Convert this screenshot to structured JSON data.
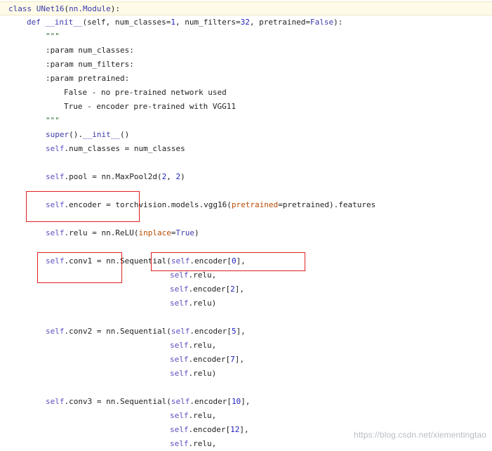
{
  "code_lines": [
    {
      "indent": 0,
      "highlight": true,
      "tokens": [
        {
          "t": "keyword",
          "v": "class "
        },
        {
          "t": "builtin",
          "v": "UNet16"
        },
        {
          "t": "text",
          "v": "("
        },
        {
          "t": "builtin",
          "v": "nn.Module"
        },
        {
          "t": "text",
          "v": "):"
        }
      ]
    },
    {
      "indent": 1,
      "tokens": [
        {
          "t": "keyword",
          "v": "def "
        },
        {
          "t": "builtin",
          "v": "__init__"
        },
        {
          "t": "text",
          "v": "(self, num_classes="
        },
        {
          "t": "number",
          "v": "1"
        },
        {
          "t": "text",
          "v": ", num_filters="
        },
        {
          "t": "number",
          "v": "32"
        },
        {
          "t": "text",
          "v": ", pretrained="
        },
        {
          "t": "keyword",
          "v": "False"
        },
        {
          "t": "text",
          "v": "):"
        }
      ]
    },
    {
      "indent": 2,
      "tokens": [
        {
          "t": "string",
          "v": "\"\"\""
        }
      ]
    },
    {
      "indent": 2,
      "tokens": [
        {
          "t": "text",
          "v": ":param num_classes:"
        }
      ]
    },
    {
      "indent": 2,
      "tokens": [
        {
          "t": "text",
          "v": ":param num_filters:"
        }
      ]
    },
    {
      "indent": 2,
      "tokens": [
        {
          "t": "text",
          "v": ":param pretrained:"
        }
      ]
    },
    {
      "indent": 3,
      "tokens": [
        {
          "t": "text",
          "v": "False - no pre-trained network used"
        }
      ]
    },
    {
      "indent": 3,
      "tokens": [
        {
          "t": "text",
          "v": "True - encoder pre-trained with VGG11"
        }
      ]
    },
    {
      "indent": 2,
      "tokens": [
        {
          "t": "string",
          "v": "\"\"\""
        }
      ]
    },
    {
      "indent": 2,
      "tokens": [
        {
          "t": "builtin",
          "v": "super"
        },
        {
          "t": "text",
          "v": "()."
        },
        {
          "t": "builtin",
          "v": "__init__"
        },
        {
          "t": "text",
          "v": "()"
        }
      ]
    },
    {
      "indent": 2,
      "tokens": [
        {
          "t": "self",
          "v": "self"
        },
        {
          "t": "text",
          "v": ".num_classes = num_classes"
        }
      ]
    },
    {
      "indent": 2,
      "tokens": []
    },
    {
      "indent": 2,
      "tokens": [
        {
          "t": "self",
          "v": "self"
        },
        {
          "t": "text",
          "v": ".pool = nn.MaxPool2d("
        },
        {
          "t": "number",
          "v": "2"
        },
        {
          "t": "text",
          "v": ", "
        },
        {
          "t": "number",
          "v": "2"
        },
        {
          "t": "text",
          "v": ")"
        }
      ]
    },
    {
      "indent": 2,
      "tokens": []
    },
    {
      "indent": 2,
      "tokens": [
        {
          "t": "self",
          "v": "self"
        },
        {
          "t": "text",
          "v": ".encoder = torchvision.models.vgg16("
        },
        {
          "t": "param",
          "v": "pretrained"
        },
        {
          "t": "text",
          "v": "=pretrained).features"
        }
      ]
    },
    {
      "indent": 2,
      "tokens": []
    },
    {
      "indent": 2,
      "tokens": [
        {
          "t": "self",
          "v": "self"
        },
        {
          "t": "text",
          "v": ".relu = nn.ReLU("
        },
        {
          "t": "param",
          "v": "inplace"
        },
        {
          "t": "text",
          "v": "="
        },
        {
          "t": "keyword",
          "v": "True"
        },
        {
          "t": "text",
          "v": ")"
        }
      ]
    },
    {
      "indent": 2,
      "tokens": []
    },
    {
      "indent": 2,
      "tokens": [
        {
          "t": "self",
          "v": "self"
        },
        {
          "t": "text",
          "v": ".conv1 = nn.Sequential("
        },
        {
          "t": "self",
          "v": "self"
        },
        {
          "t": "text",
          "v": ".encoder["
        },
        {
          "t": "number",
          "v": "0"
        },
        {
          "t": "text",
          "v": "],"
        }
      ]
    },
    {
      "indent": 4,
      "tokens": [
        {
          "t": "self",
          "v": "self"
        },
        {
          "t": "text",
          "v": ".relu,"
        }
      ]
    },
    {
      "indent": 4,
      "tokens": [
        {
          "t": "self",
          "v": "self"
        },
        {
          "t": "text",
          "v": ".encoder["
        },
        {
          "t": "number",
          "v": "2"
        },
        {
          "t": "text",
          "v": "],"
        }
      ]
    },
    {
      "indent": 4,
      "tokens": [
        {
          "t": "self",
          "v": "self"
        },
        {
          "t": "text",
          "v": ".relu)"
        }
      ]
    },
    {
      "indent": 2,
      "tokens": []
    },
    {
      "indent": 2,
      "tokens": [
        {
          "t": "self",
          "v": "self"
        },
        {
          "t": "text",
          "v": ".conv2 = nn.Sequential("
        },
        {
          "t": "self",
          "v": "self"
        },
        {
          "t": "text",
          "v": ".encoder["
        },
        {
          "t": "number",
          "v": "5"
        },
        {
          "t": "text",
          "v": "],"
        }
      ]
    },
    {
      "indent": 4,
      "tokens": [
        {
          "t": "self",
          "v": "self"
        },
        {
          "t": "text",
          "v": ".relu,"
        }
      ]
    },
    {
      "indent": 4,
      "tokens": [
        {
          "t": "self",
          "v": "self"
        },
        {
          "t": "text",
          "v": ".encoder["
        },
        {
          "t": "number",
          "v": "7"
        },
        {
          "t": "text",
          "v": "],"
        }
      ]
    },
    {
      "indent": 4,
      "tokens": [
        {
          "t": "self",
          "v": "self"
        },
        {
          "t": "text",
          "v": ".relu)"
        }
      ]
    },
    {
      "indent": 2,
      "tokens": []
    },
    {
      "indent": 2,
      "tokens": [
        {
          "t": "self",
          "v": "self"
        },
        {
          "t": "text",
          "v": ".conv3 = nn.Sequential("
        },
        {
          "t": "self",
          "v": "self"
        },
        {
          "t": "text",
          "v": ".encoder["
        },
        {
          "t": "number",
          "v": "10"
        },
        {
          "t": "text",
          "v": "],"
        }
      ]
    },
    {
      "indent": 4,
      "tokens": [
        {
          "t": "self",
          "v": "self"
        },
        {
          "t": "text",
          "v": ".relu,"
        }
      ]
    },
    {
      "indent": 4,
      "tokens": [
        {
          "t": "self",
          "v": "self"
        },
        {
          "t": "text",
          "v": ".encoder["
        },
        {
          "t": "number",
          "v": "12"
        },
        {
          "t": "text",
          "v": "],"
        }
      ]
    },
    {
      "indent": 4,
      "tokens": [
        {
          "t": "self",
          "v": "self"
        },
        {
          "t": "text",
          "v": ".relu,"
        }
      ]
    }
  ],
  "annotation_boxes": [
    "encoder-highlight",
    "conv1-highlight",
    "encoder0-highlight"
  ],
  "watermark": "https://blog.csdn.net/xiementingtao",
  "colors": {
    "highlight_bg": "#fffbe8",
    "annotation": "#e02020",
    "keyword": "#3a3aa8",
    "number": "#1d1dc0",
    "param": "#b64a00"
  }
}
